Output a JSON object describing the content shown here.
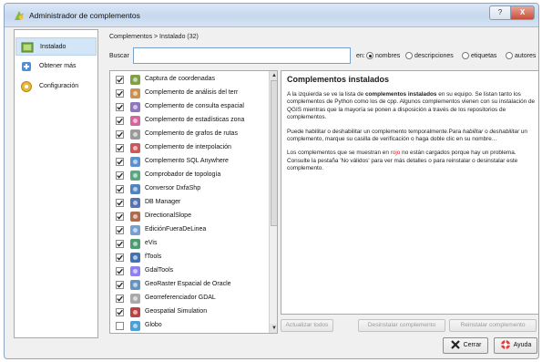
{
  "window": {
    "title": "Administrador de complementos",
    "help_label": "?",
    "close_label": "X"
  },
  "sidebar": {
    "items": [
      {
        "label": "Instalado",
        "icon": "installed-plugin-icon",
        "selected": true
      },
      {
        "label": "Obtener más",
        "icon": "get-more-icon",
        "selected": false
      },
      {
        "label": "Configuración",
        "icon": "settings-gear-icon",
        "selected": false
      }
    ]
  },
  "header": {
    "breadcrumb": "Complementos > Instalado (32)"
  },
  "search": {
    "label": "Buscar",
    "value": "",
    "in_label": "en:"
  },
  "filters": [
    {
      "label": "nombres",
      "selected": true
    },
    {
      "label": "descripciones",
      "selected": false
    },
    {
      "label": "etiquetas",
      "selected": false
    },
    {
      "label": "autores",
      "selected": false
    }
  ],
  "plugins": [
    {
      "name": "Captura de coordenadas",
      "checked": true,
      "icon": "crosshair-icon"
    },
    {
      "name": "Complemento de análisis del terr",
      "checked": true,
      "icon": "terrain-icon"
    },
    {
      "name": "Complemento de consulta espacial",
      "checked": true,
      "icon": "spatial-query-icon"
    },
    {
      "name": "Complemento de estadísticas zona",
      "checked": true,
      "icon": "zonal-stats-icon"
    },
    {
      "name": "Complemento de grafos de rutas",
      "checked": true,
      "icon": "road-graph-icon"
    },
    {
      "name": "Complemento de interpolación",
      "checked": true,
      "icon": "interpolation-icon"
    },
    {
      "name": "Complemento SQL Anywhere",
      "checked": true,
      "icon": "sql-anywhere-icon"
    },
    {
      "name": "Comprobador de topología",
      "checked": true,
      "icon": "topology-icon"
    },
    {
      "name": "Conversor DxfaShp",
      "checked": true,
      "icon": "dxf-converter-icon"
    },
    {
      "name": "DB Manager",
      "checked": true,
      "icon": "database-icon"
    },
    {
      "name": "DirectionalSlope",
      "checked": true,
      "icon": "slope-icon"
    },
    {
      "name": "EdiciónFueraDeLinea",
      "checked": true,
      "icon": "offline-edit-icon"
    },
    {
      "name": "eVis",
      "checked": true,
      "icon": "evis-icon"
    },
    {
      "name": "fTools",
      "checked": true,
      "icon": "ftools-icon"
    },
    {
      "name": "GdalTools",
      "checked": true,
      "icon": "gdal-icon"
    },
    {
      "name": "GeoRaster Espacial de Oracle",
      "checked": true,
      "icon": "georaster-icon"
    },
    {
      "name": "Georreferenciador GDAL",
      "checked": true,
      "icon": "georeferencer-icon"
    },
    {
      "name": "Geospatial Simulation",
      "checked": true,
      "icon": "simulation-icon"
    },
    {
      "name": "Globo",
      "checked": false,
      "icon": "globe-icon"
    }
  ],
  "description": {
    "title": "Complementos instalados",
    "p1_a": "A la izquierda se ve la lista de ",
    "p1_b": "complementos instalados",
    "p1_c": " en su equipo. Se listan tanto los complementos de Python como los de cpp. Algunos complementos vienen con su instalación de QGIS mientras que la mayoría se ponen a disposición a través de los repositorios de complementos.",
    "p2_a": "Puede habilitar o deshabilitar un complemento temporalmente.Para ",
    "p2_b": "habilitar",
    "p2_c": " o ",
    "p2_d": "deshabilitar",
    "p2_e": " un complemento, marque su casilla de verificación o haga doble clic en su nombre...",
    "p3_a": "Los complementos que se muestran en ",
    "p3_b": "rojo",
    "p3_c": " no están cargados porque hay un problema. Consulte la pestaña 'No válidos' para ver más detalles o para reinstalar o desinstalar este complemento."
  },
  "buttons": {
    "update_all": "Actualizar todos",
    "uninstall": "Desinstalar complemento",
    "reinstall": "Reinstalar complemento",
    "close": "Cerrar",
    "help": "Ayuda"
  }
}
